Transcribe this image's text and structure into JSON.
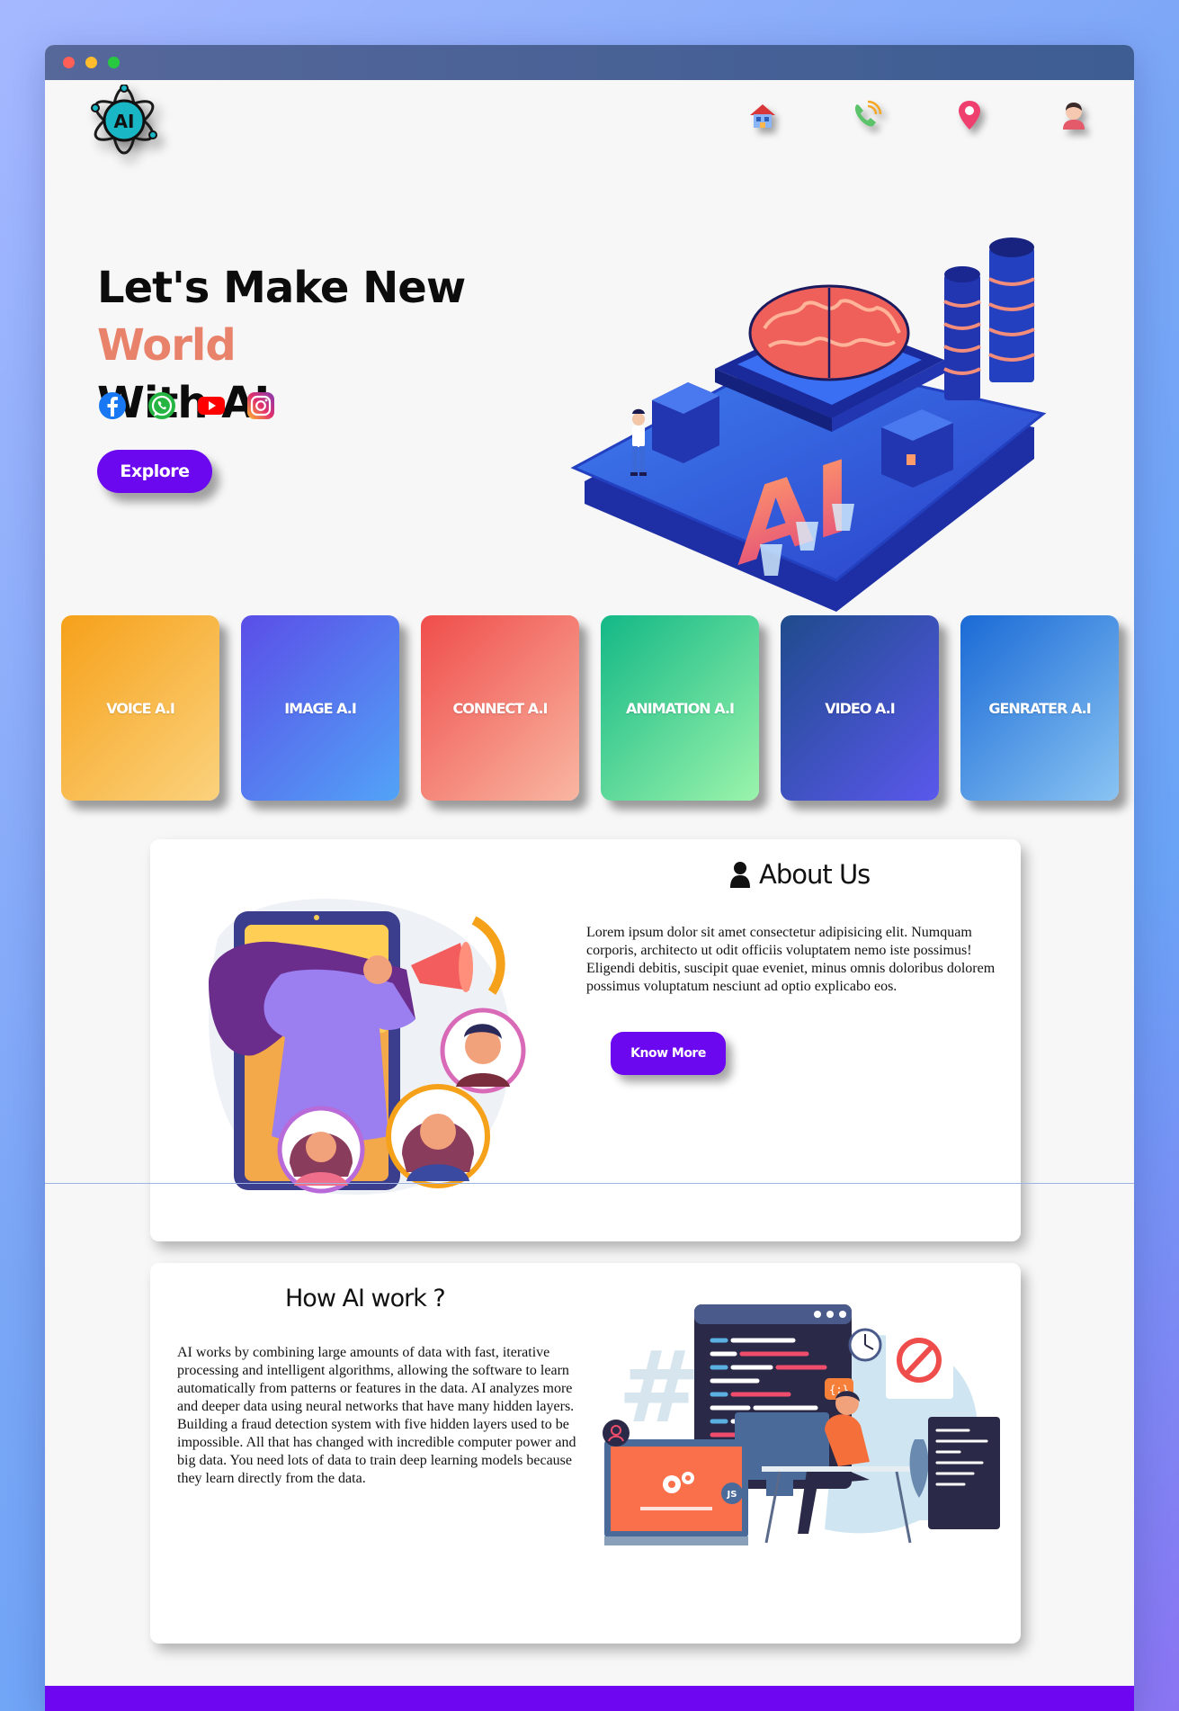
{
  "hero": {
    "title_part1": "Let's Make New ",
    "title_accent": "World",
    "title_part2": "With AI",
    "explore_label": "Explore",
    "accent_color": "#e9826a"
  },
  "logo": {
    "text": "AI"
  },
  "nav": {
    "icons": [
      "home-icon",
      "phone-icon",
      "location-pin-icon",
      "profile-icon"
    ]
  },
  "social": {
    "icons": [
      "facebook-icon",
      "whatsapp-icon",
      "youtube-icon",
      "instagram-icon"
    ]
  },
  "cards": [
    {
      "label": "VOICE A.I"
    },
    {
      "label": "IMAGE A.I"
    },
    {
      "label": "CONNECT A.I"
    },
    {
      "label": "ANIMATION A.I"
    },
    {
      "label": "VIDEO A.I"
    },
    {
      "label": "GENRATER A.I"
    }
  ],
  "about": {
    "title": "About Us",
    "text": "Lorem ipsum dolor sit amet consectetur adipisicing elit. Numquam corporis, architecto ut odit officiis voluptatem nemo iste possimus! Eligendi debitis, suscipit quae eveniet, minus omnis doloribus dolorem possimus voluptatum nesciunt ad optio explicabo eos.",
    "button_label": "Know More"
  },
  "how": {
    "title": "How AI work ?",
    "text": "AI works by combining large amounts of data with fast, iterative processing and intelligent algorithms, allowing the software to learn automatically from patterns or features in the data. AI analyzes more and deeper data using neural networks that have many hidden layers. Building a fraud detection system with five hidden layers used to be impossible. All that has changed with incredible computer power and big data. You need lots of data to train deep learning models because they learn directly from the data."
  },
  "illustration": {
    "chip_text": "AI",
    "code_badge": "{;}",
    "js_badge": "JS"
  },
  "colors": {
    "primary": "#6b08ef",
    "footer": "#6e06f2"
  }
}
